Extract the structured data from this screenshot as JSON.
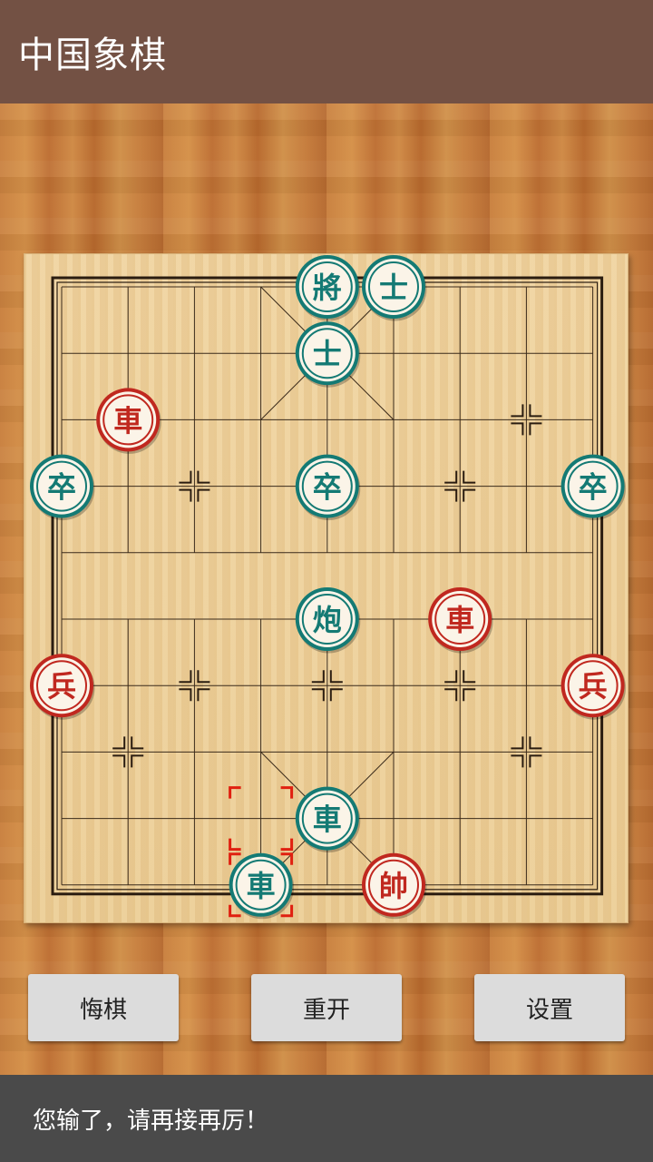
{
  "app": {
    "title": "中国象棋"
  },
  "buttons": {
    "undo": "悔棋",
    "restart": "重开",
    "settings": "设置"
  },
  "status": {
    "message": "您输了，请再接再厉！"
  },
  "colors": {
    "red_side": "#c0281f",
    "teal_side": "#147a74",
    "selection": "#e02010"
  },
  "board": {
    "columns": 9,
    "rows": 10,
    "river": [
      "",
      ""
    ],
    "pieces": [
      {
        "label": "將",
        "side": "teal",
        "col": 4,
        "row": 0,
        "name": "teal-general"
      },
      {
        "label": "士",
        "side": "teal",
        "col": 5,
        "row": 0,
        "name": "teal-advisor-1"
      },
      {
        "label": "士",
        "side": "teal",
        "col": 4,
        "row": 1,
        "name": "teal-advisor-2"
      },
      {
        "label": "車",
        "side": "red",
        "col": 1,
        "row": 2,
        "name": "red-chariot-1"
      },
      {
        "label": "卒",
        "side": "teal",
        "col": 0,
        "row": 3,
        "name": "teal-soldier-1"
      },
      {
        "label": "卒",
        "side": "teal",
        "col": 4,
        "row": 3,
        "name": "teal-soldier-2"
      },
      {
        "label": "卒",
        "side": "teal",
        "col": 8,
        "row": 3,
        "name": "teal-soldier-3"
      },
      {
        "label": "炮",
        "side": "teal",
        "col": 4,
        "row": 5,
        "name": "teal-cannon"
      },
      {
        "label": "車",
        "side": "red",
        "col": 6,
        "row": 5,
        "name": "red-chariot-2"
      },
      {
        "label": "兵",
        "side": "red",
        "col": 0,
        "row": 6,
        "name": "red-soldier-1"
      },
      {
        "label": "兵",
        "side": "red",
        "col": 8,
        "row": 6,
        "name": "red-soldier-2"
      },
      {
        "label": "車",
        "side": "teal",
        "col": 4,
        "row": 8,
        "name": "teal-chariot-1"
      },
      {
        "label": "車",
        "side": "teal",
        "col": 3,
        "row": 9,
        "name": "teal-chariot-2"
      },
      {
        "label": "帥",
        "side": "red",
        "col": 5,
        "row": 9,
        "name": "red-general"
      }
    ],
    "last_move_markers": [
      {
        "col": 3,
        "row": 8
      },
      {
        "col": 3,
        "row": 9
      }
    ]
  }
}
